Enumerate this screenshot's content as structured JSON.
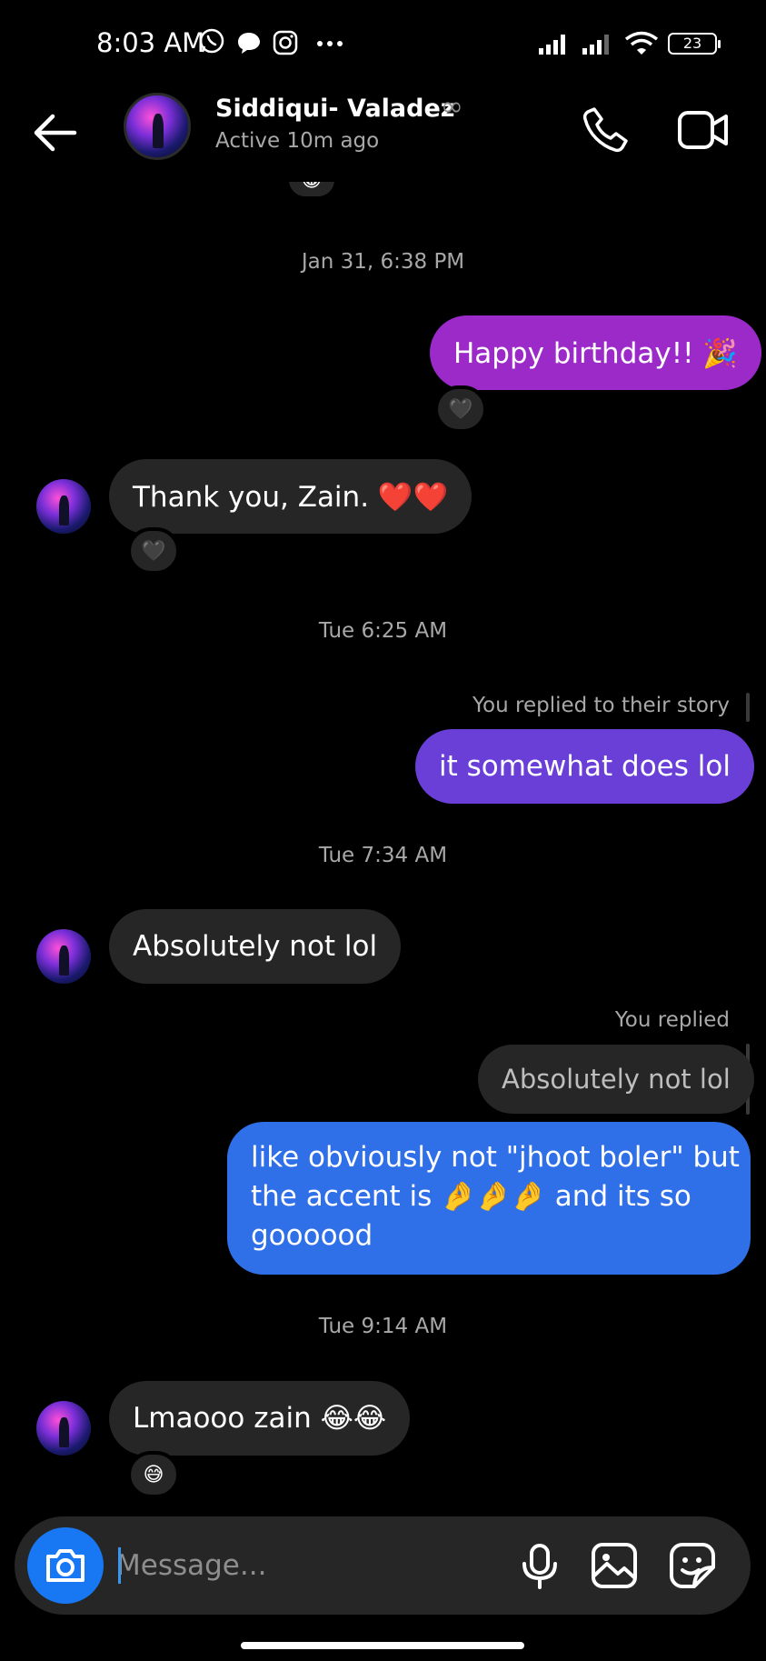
{
  "status_bar": {
    "time": "8:03 AM",
    "battery": "23",
    "left_icons": [
      "whatsapp-icon",
      "chat-bubble-icon",
      "instagram-icon",
      "more-dots-icon"
    ],
    "right_icons": [
      "signal-icon",
      "signal-icon",
      "wifi-icon",
      "battery-icon"
    ]
  },
  "header": {
    "name": "Siddiqui- Valadez",
    "name_suffix": "∞",
    "status": "Active 10m ago"
  },
  "messages": {
    "ts1": "Jan 31, 6:38 PM",
    "m1": "Happy birthday!! 🎉",
    "m1_reaction": "🖤",
    "m2": "Thank you, Zain. ❤️❤️",
    "m2_reaction": "🖤",
    "ts2": "Tue 6:25 AM",
    "m3_meta": "You replied to their story",
    "m3": "it somewhat does lol",
    "ts3": "Tue 7:34 AM",
    "m4": "Absolutely not lol",
    "m5_meta": "You replied",
    "m5_quote": "Absolutely not lol",
    "m5_line1": "like obviously not \"jhoot boler\" but",
    "m5_line2": "the accent is 🤌🤌🤌 and its so",
    "m5_line3": "goooood",
    "ts4": "Tue 9:14 AM",
    "m6": "Lmaooo zain 😂😂",
    "m6_reaction": "😅",
    "top_reaction": "😂"
  },
  "composer": {
    "placeholder": "Message..."
  },
  "colors": {
    "background": "#000000",
    "incoming_bubble": "#262626",
    "outgoing_purple": "#9b2ac9",
    "outgoing_violet": "#6a3fd8",
    "outgoing_blue": "#2f6fe8",
    "accent": "#1877f2"
  }
}
